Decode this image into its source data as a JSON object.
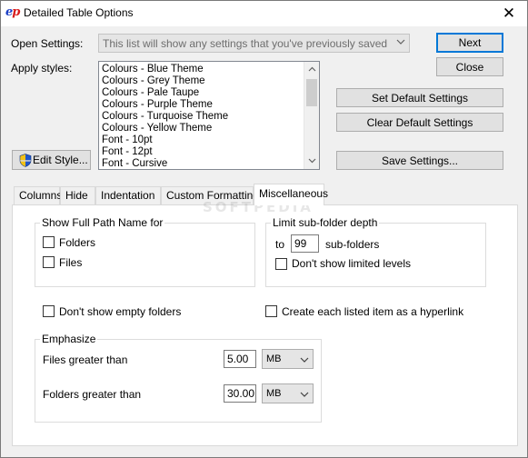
{
  "window": {
    "title": "Detailed Table Options",
    "logo": {
      "e": "e",
      "p": "p"
    },
    "close_glyph": "✕"
  },
  "open_settings": {
    "label": "Open Settings:",
    "placeholder": "This list will show any settings that you've previously saved"
  },
  "apply_styles": {
    "label": "Apply styles:",
    "items": [
      "Colours - Blue Theme",
      "Colours - Grey Theme",
      "Colours - Pale Taupe",
      "Colours - Purple Theme",
      "Colours - Turquoise Theme",
      "Colours - Yellow Theme",
      "Font - 10pt",
      "Font - 12pt",
      "Font - Cursive"
    ]
  },
  "buttons": {
    "next": "Next",
    "close": "Close",
    "set_default": "Set Default Settings",
    "clear_default": "Clear Default Settings",
    "save_settings": "Save Settings...",
    "edit_style": "Edit Style..."
  },
  "tabs": [
    {
      "label": "Columns",
      "active": false
    },
    {
      "label": "Hide",
      "active": false
    },
    {
      "label": "Indentation",
      "active": false
    },
    {
      "label": "Custom Formatting",
      "active": false
    },
    {
      "label": "Miscellaneous",
      "active": true
    }
  ],
  "misc": {
    "full_path": {
      "title": "Show Full Path Name for",
      "folders": {
        "label": "Folders",
        "checked": false
      },
      "files": {
        "label": "Files",
        "checked": false
      }
    },
    "limit_depth": {
      "title": "Limit sub-folder depth",
      "to_label": "to",
      "value": "99",
      "suffix": "sub-folders",
      "dont_show": {
        "label": "Don't show limited levels",
        "checked": false
      }
    },
    "dont_show_empty": {
      "label": "Don't show empty folders",
      "checked": false
    },
    "hyperlink": {
      "label": "Create each listed item as a hyperlink",
      "checked": false
    },
    "emphasize": {
      "title": "Emphasize",
      "files": {
        "label": "Files greater than",
        "value": "5.00",
        "unit": "MB"
      },
      "folders": {
        "label": "Folders greater than",
        "value": "30.00",
        "unit": "MB"
      }
    }
  },
  "watermark": "SOFTPEDIA",
  "colors": {
    "accent": "#0078d7",
    "logo_blue": "#1a3dc4",
    "logo_red": "#d81b1b"
  },
  "icons": {
    "edit_style": "shield-icon",
    "dropdown": "chevron-down-icon",
    "scroll_up": "arrow-up-icon",
    "scroll_down": "arrow-down-icon"
  }
}
